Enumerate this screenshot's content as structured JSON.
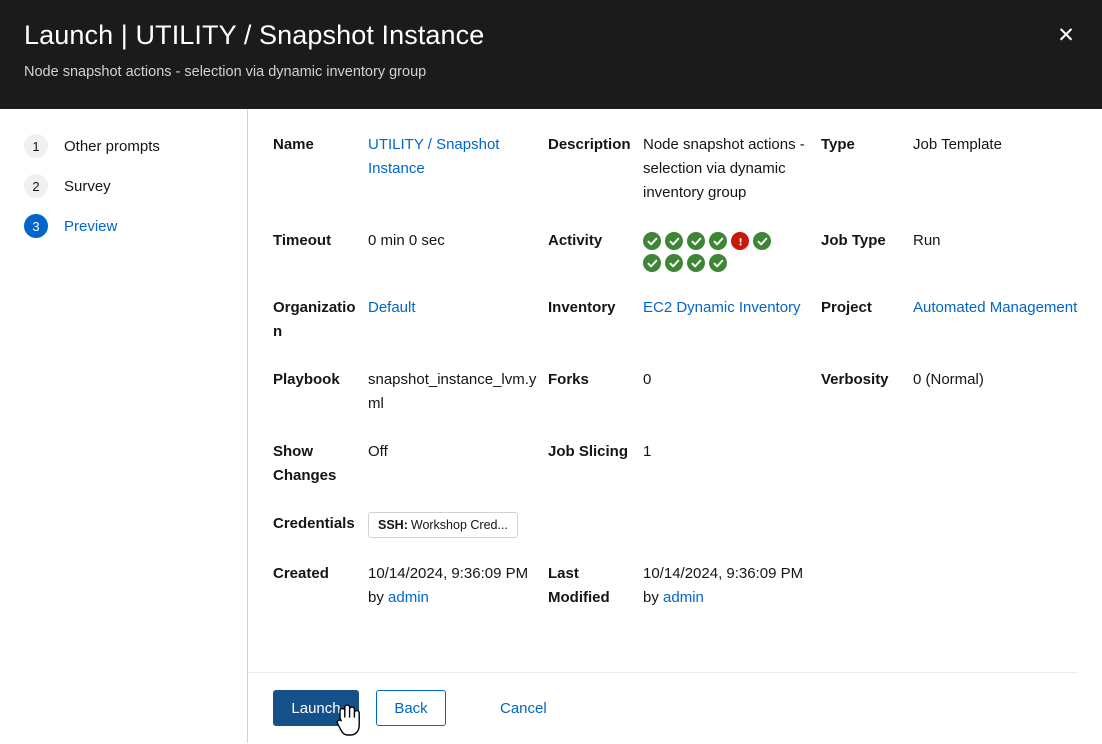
{
  "header": {
    "title": "Launch | UTILITY / Snapshot Instance",
    "subtitle": "Node snapshot actions - selection via dynamic inventory group",
    "close_label": "✕"
  },
  "wizard": {
    "steps": [
      {
        "num": "1",
        "label": "Other prompts",
        "active": false
      },
      {
        "num": "2",
        "label": "Survey",
        "active": false
      },
      {
        "num": "3",
        "label": "Preview",
        "active": true
      }
    ]
  },
  "details": {
    "name": {
      "label": "Name",
      "value": "UTILITY / Snapshot Instance"
    },
    "description": {
      "label": "Description",
      "value": "Node snapshot actions - selection via dynamic inventory group"
    },
    "type": {
      "label": "Type",
      "value": "Job Template"
    },
    "timeout": {
      "label": "Timeout",
      "value": "0 min 0 sec"
    },
    "activity": {
      "label": "Activity",
      "statuses": [
        "ok",
        "ok",
        "ok",
        "ok",
        "err",
        "ok",
        "ok",
        "ok",
        "ok",
        "ok"
      ]
    },
    "job_type": {
      "label": "Job Type",
      "value": "Run"
    },
    "organization": {
      "label": "Organization",
      "value": "Default"
    },
    "inventory": {
      "label": "Inventory",
      "value": "EC2 Dynamic Inventory"
    },
    "project": {
      "label": "Project",
      "value": "Automated Management"
    },
    "playbook": {
      "label": "Playbook",
      "value": "snapshot_instance_lvm.yml"
    },
    "forks": {
      "label": "Forks",
      "value": "0"
    },
    "verbosity": {
      "label": "Verbosity",
      "value": "0 (Normal)"
    },
    "show_changes": {
      "label": "Show Changes",
      "value": "Off"
    },
    "job_slicing": {
      "label": "Job Slicing",
      "value": "1"
    },
    "credentials": {
      "label": "Credentials",
      "chip_prefix": "SSH:",
      "chip_value": "Workshop Cred..."
    },
    "created": {
      "label": "Created",
      "value": "10/14/2024, 9:36:09 PM by ",
      "user": "admin"
    },
    "last_modified": {
      "label": "Last Modified",
      "value": "10/14/2024, 9:36:09 PM by ",
      "user": "admin"
    }
  },
  "footer": {
    "launch_label": "Launch",
    "back_label": "Back",
    "cancel_label": "Cancel"
  },
  "colors": {
    "header_bg": "#1b1b1b",
    "link": "#0066cc",
    "primary_button": "#14508a",
    "status_ok": "#3e8635",
    "status_error": "#c9190b"
  }
}
